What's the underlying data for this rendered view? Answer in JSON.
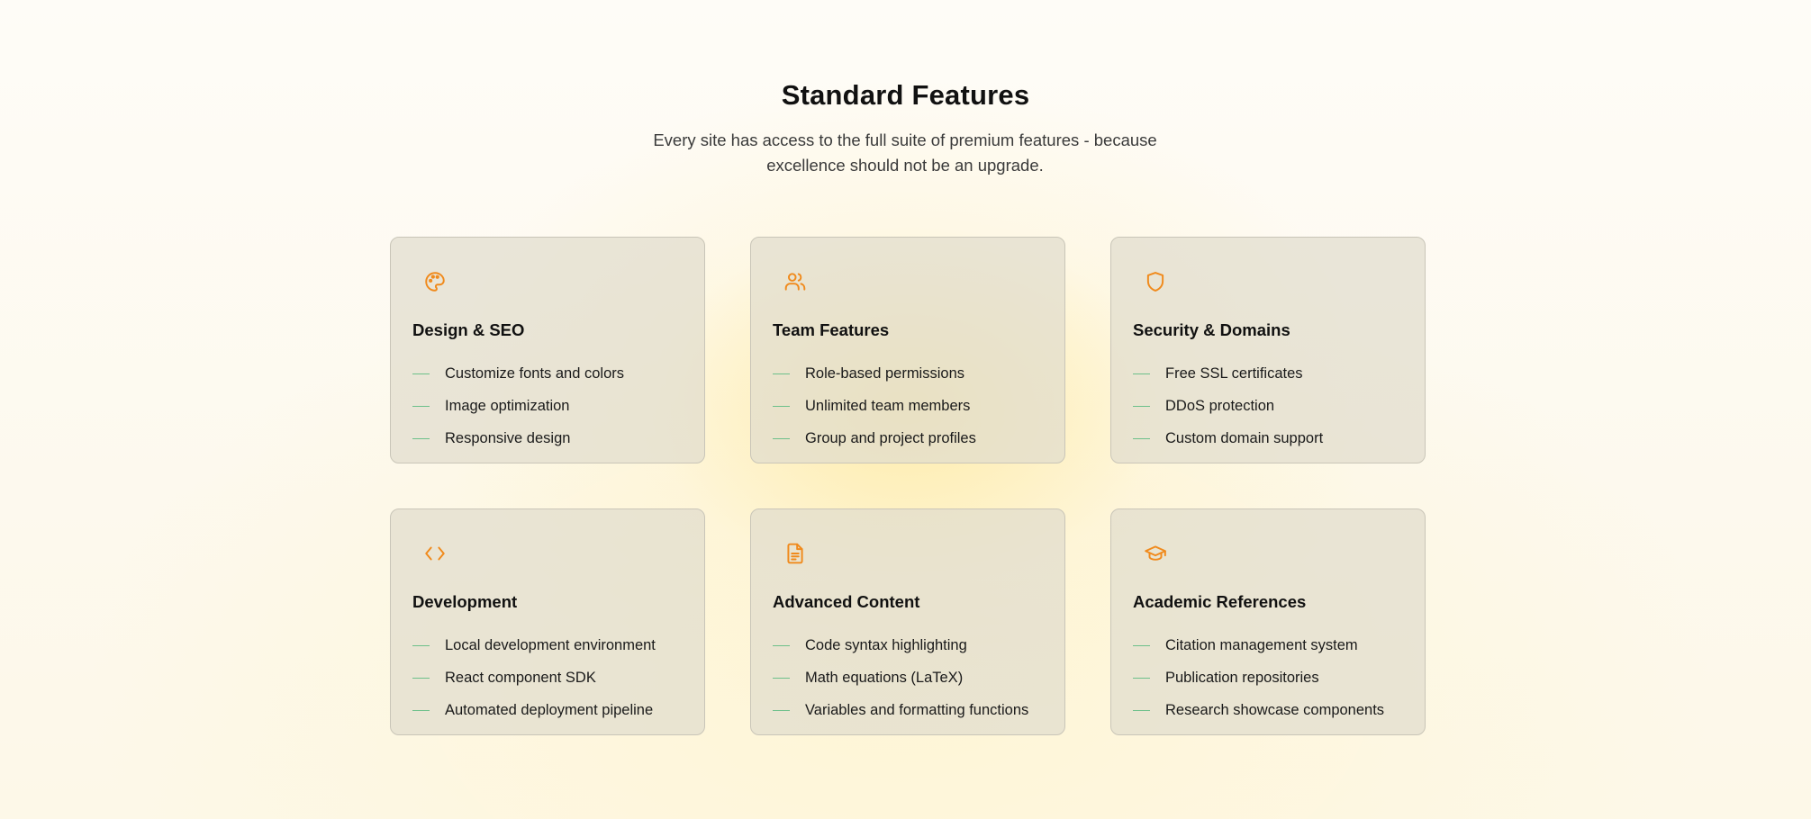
{
  "header": {
    "title": "Standard Features",
    "subtitle": "Every site has access to the full suite of premium features - because excellence should not be an upgrade."
  },
  "colors": {
    "icon_accent": "#f08a1c",
    "dash_accent": "#6cc08a"
  },
  "cards": [
    {
      "icon": "palette-icon",
      "title": "Design & SEO",
      "items": [
        "Customize fonts and colors",
        "Image optimization",
        "Responsive design"
      ]
    },
    {
      "icon": "users-icon",
      "title": "Team Features",
      "items": [
        "Role-based permissions",
        "Unlimited team members",
        "Group and project profiles"
      ]
    },
    {
      "icon": "shield-icon",
      "title": "Security & Domains",
      "items": [
        "Free SSL certificates",
        "DDoS protection",
        "Custom domain support"
      ]
    },
    {
      "icon": "code-icon",
      "title": "Development",
      "items": [
        "Local development environment",
        "React component SDK",
        "Automated deployment pipeline"
      ]
    },
    {
      "icon": "document-icon",
      "title": "Advanced Content",
      "items": [
        "Code syntax highlighting",
        "Math equations (LaTeX)",
        "Variables and formatting functions"
      ]
    },
    {
      "icon": "graduation-cap-icon",
      "title": "Academic References",
      "items": [
        "Citation management system",
        "Publication repositories",
        "Research showcase components"
      ]
    }
  ]
}
